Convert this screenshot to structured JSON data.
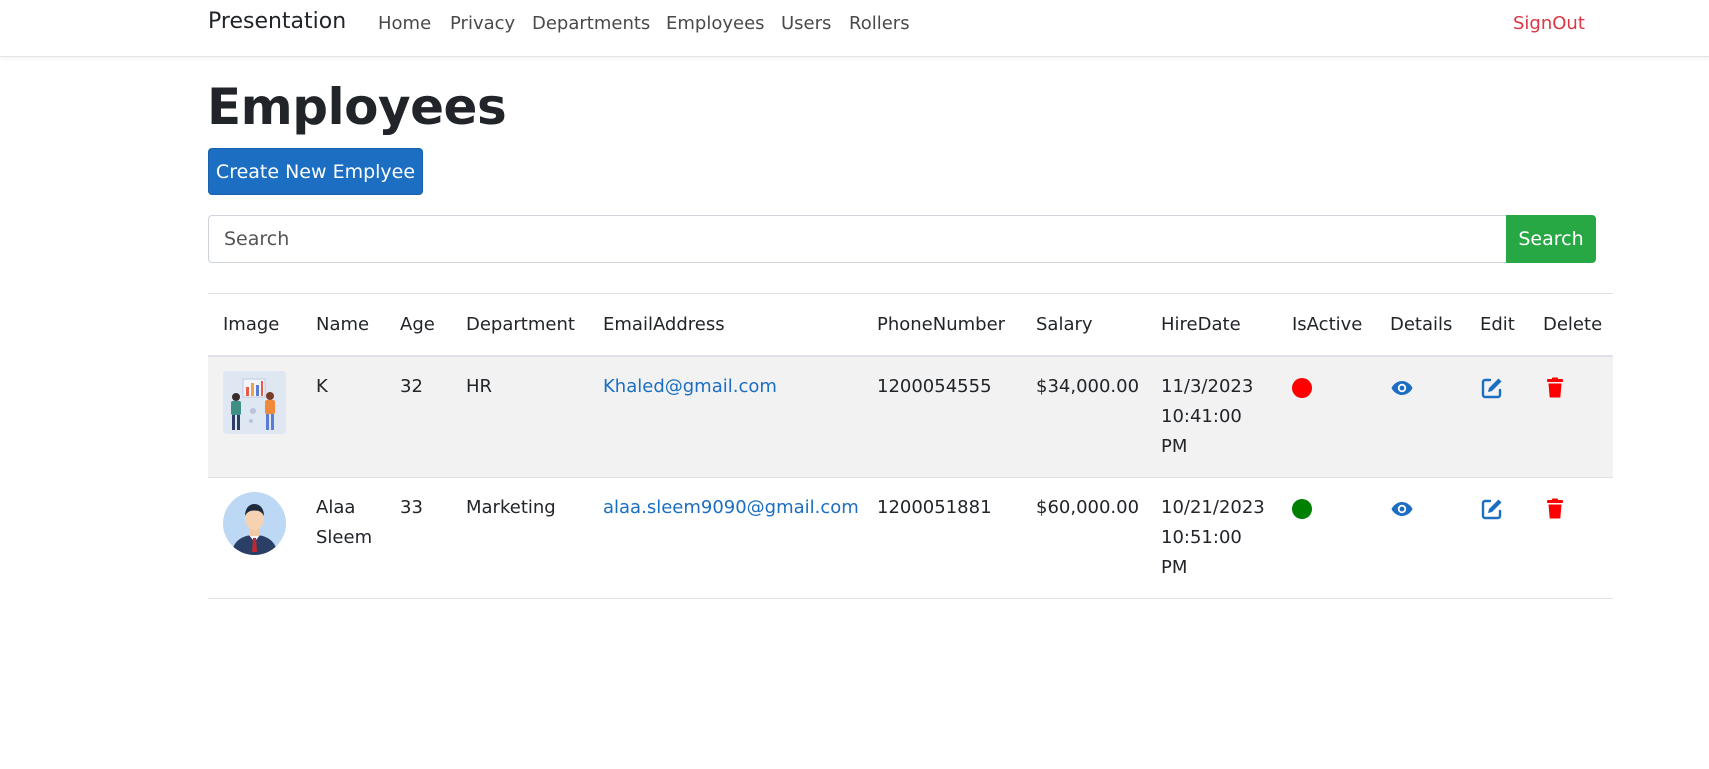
{
  "nav": {
    "brand": "Presentation",
    "links": [
      "Home",
      "Privacy",
      "Departments",
      "Employees",
      "Users",
      "Rollers"
    ],
    "signout": "SignOut"
  },
  "page": {
    "title": "Employees",
    "create_label": "Create New Emplyee"
  },
  "search": {
    "placeholder": "Search",
    "button_label": "Search"
  },
  "table": {
    "headers": [
      "Image",
      "Name",
      "Age",
      "Department",
      "EmailAddress",
      "PhoneNumber",
      "Salary",
      "HireDate",
      "IsActive",
      "Details",
      "Edit",
      "Delete"
    ],
    "rows": [
      {
        "image": "team-illustration",
        "name_line1": "K",
        "name_line2": "",
        "age": "32",
        "department": "HR",
        "email": "Khaled@gmail.com",
        "phone": "1200054555",
        "salary": "$34,000.00",
        "hire_date_line1": "11/3/2023",
        "hire_date_line2": "10:41:00",
        "hire_date_line3": "PM",
        "is_active": false,
        "status_color": "#ff0000"
      },
      {
        "image": "businessman-avatar",
        "name_line1": "Alaa",
        "name_line2": "Sleem",
        "age": "33",
        "department": "Marketing",
        "email": "alaa.sleem9090@gmail.com",
        "phone": "1200051881",
        "salary": "$60,000.00",
        "hire_date_line1": "10/21/2023",
        "hire_date_line2": "10:51:00",
        "hire_date_line3": "PM",
        "is_active": true,
        "status_color": "#008000"
      }
    ]
  },
  "colors": {
    "primary": "#1b6ec2",
    "success": "#28a745",
    "danger": "#ff0000",
    "signout": "#dc3545"
  },
  "icons": {
    "details": "eye-icon",
    "edit": "edit-icon",
    "delete": "trash-icon"
  }
}
